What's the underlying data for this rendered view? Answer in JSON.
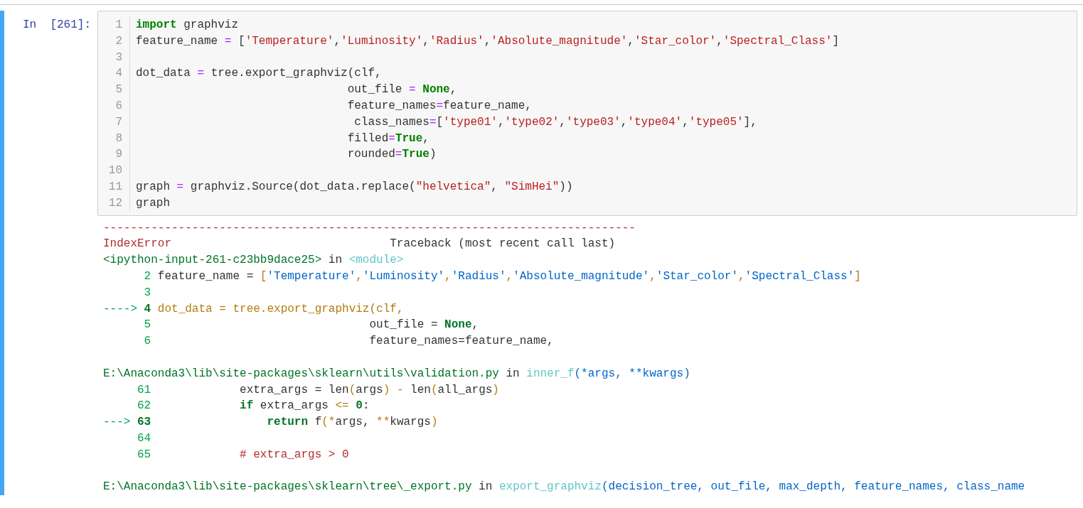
{
  "cell": {
    "selected": true,
    "prompt": "In  [261]:",
    "lines": [
      {
        "number": "1",
        "tokens": [
          {
            "kind": "keyword",
            "text": "import"
          },
          {
            "kind": "plain",
            "text": " graphviz"
          }
        ]
      },
      {
        "number": "2",
        "tokens": [
          {
            "kind": "plain",
            "text": "feature_name "
          },
          {
            "kind": "operator",
            "text": "="
          },
          {
            "kind": "plain",
            "text": " ["
          },
          {
            "kind": "string",
            "text": "'Temperature'"
          },
          {
            "kind": "plain",
            "text": ","
          },
          {
            "kind": "string",
            "text": "'Luminosity'"
          },
          {
            "kind": "plain",
            "text": ","
          },
          {
            "kind": "string",
            "text": "'Radius'"
          },
          {
            "kind": "plain",
            "text": ","
          },
          {
            "kind": "string",
            "text": "'Absolute_magnitude'"
          },
          {
            "kind": "plain",
            "text": ","
          },
          {
            "kind": "string",
            "text": "'Star_color'"
          },
          {
            "kind": "plain",
            "text": ","
          },
          {
            "kind": "string",
            "text": "'Spectral_Class'"
          },
          {
            "kind": "plain",
            "text": "]"
          }
        ]
      },
      {
        "number": "3"
      },
      {
        "number": "4",
        "tokens": [
          {
            "kind": "plain",
            "text": "dot_data "
          },
          {
            "kind": "operator",
            "text": "="
          },
          {
            "kind": "plain",
            "text": " tree.export_graphviz(clf,"
          }
        ]
      },
      {
        "number": "5",
        "tokens": [
          {
            "kind": "plain",
            "text": "                               out_file "
          },
          {
            "kind": "operator",
            "text": "="
          },
          {
            "kind": "constant",
            "text": " None"
          },
          {
            "kind": "plain",
            "text": ","
          }
        ]
      },
      {
        "number": "6",
        "tokens": [
          {
            "kind": "plain",
            "text": "                               feature_names"
          },
          {
            "kind": "operator",
            "text": "="
          },
          {
            "kind": "plain",
            "text": "feature_name,"
          }
        ]
      },
      {
        "number": "7",
        "tokens": [
          {
            "kind": "plain",
            "text": "                                class_names"
          },
          {
            "kind": "operator",
            "text": "="
          },
          {
            "kind": "plain",
            "text": "["
          },
          {
            "kind": "string",
            "text": "'type01'"
          },
          {
            "kind": "plain",
            "text": ","
          },
          {
            "kind": "string",
            "text": "'type02'"
          },
          {
            "kind": "plain",
            "text": ","
          },
          {
            "kind": "string",
            "text": "'type03'"
          },
          {
            "kind": "plain",
            "text": ","
          },
          {
            "kind": "string",
            "text": "'type04'"
          },
          {
            "kind": "plain",
            "text": ","
          },
          {
            "kind": "string",
            "text": "'type05'"
          },
          {
            "kind": "plain",
            "text": "],"
          }
        ]
      },
      {
        "number": "8",
        "tokens": [
          {
            "kind": "plain",
            "text": "                               filled"
          },
          {
            "kind": "operator",
            "text": "="
          },
          {
            "kind": "constant",
            "text": "True"
          },
          {
            "kind": "plain",
            "text": ","
          }
        ]
      },
      {
        "number": "9",
        "tokens": [
          {
            "kind": "plain",
            "text": "                               rounded"
          },
          {
            "kind": "operator",
            "text": "="
          },
          {
            "kind": "constant",
            "text": "True"
          },
          {
            "kind": "plain",
            "text": ")"
          }
        ]
      },
      {
        "number": "10"
      },
      {
        "number": "11",
        "tokens": [
          {
            "kind": "plain",
            "text": "graph "
          },
          {
            "kind": "operator",
            "text": "="
          },
          {
            "kind": "plain",
            "text": " graphviz.Source(dot_data.replace("
          },
          {
            "kind": "string",
            "text": "\"helvetica\""
          },
          {
            "kind": "plain",
            "text": ", "
          },
          {
            "kind": "string",
            "text": "\"SimHei\""
          },
          {
            "kind": "plain",
            "text": "))"
          }
        ]
      },
      {
        "number": "12",
        "tokens": [
          {
            "kind": "plain",
            "text": "graph"
          }
        ]
      }
    ]
  },
  "output": {
    "separator": "------------------------------------------------------------------------------",
    "header": [
      {
        "kind": "error",
        "text": "IndexError"
      },
      {
        "kind": "plain",
        "text": "                                Traceback (most recent call last)"
      }
    ],
    "frames": [
      {
        "lines": [
          [
            {
              "kind": "file",
              "text": "<ipython-input-261-c23bb9dace25>"
            },
            {
              "kind": "plain",
              "text": " in "
            },
            {
              "kind": "function",
              "text": "<module>"
            }
          ],
          [
            {
              "kind": "line_number",
              "text": "      2"
            },
            {
              "kind": "plain",
              "text": " feature_name = "
            },
            {
              "kind": "punct",
              "text": "["
            },
            {
              "kind": "tb_string",
              "text": "'Temperature'"
            },
            {
              "kind": "punct",
              "text": ","
            },
            {
              "kind": "tb_string",
              "text": "'Luminosity'"
            },
            {
              "kind": "punct",
              "text": ","
            },
            {
              "kind": "tb_string",
              "text": "'Radius'"
            },
            {
              "kind": "punct",
              "text": ","
            },
            {
              "kind": "tb_string",
              "text": "'Absolute_magnitude'"
            },
            {
              "kind": "punct",
              "text": ","
            },
            {
              "kind": "tb_string",
              "text": "'Star_color'"
            },
            {
              "kind": "punct",
              "text": ","
            },
            {
              "kind": "tb_string",
              "text": "'Spectral_Class'"
            },
            {
              "kind": "punct",
              "text": "]"
            }
          ],
          [
            {
              "kind": "line_number",
              "text": "      3"
            }
          ],
          [
            {
              "kind": "arrow",
              "text": "----> "
            },
            {
              "kind": "current_number",
              "text": "4"
            },
            {
              "kind": "current_code",
              "text": " dot_data = tree.export_graphviz(clf,"
            }
          ],
          [
            {
              "kind": "line_number",
              "text": "      5"
            },
            {
              "kind": "plain",
              "text": "                                out_file = "
            },
            {
              "kind": "tb_keyword",
              "text": "None"
            },
            {
              "kind": "plain",
              "text": ","
            }
          ],
          [
            {
              "kind": "line_number",
              "text": "      6"
            },
            {
              "kind": "plain",
              "text": "                                feature_names=feature_name,"
            }
          ]
        ]
      },
      {
        "lines": [
          [
            {
              "kind": "file",
              "text": "E:\\Anaconda3\\lib\\site-packages\\sklearn\\utils\\validation.py"
            },
            {
              "kind": "plain",
              "text": " in "
            },
            {
              "kind": "function",
              "text": "inner_f"
            },
            {
              "kind": "arguments",
              "text": "(*args, **kwargs)"
            }
          ],
          [
            {
              "kind": "line_number",
              "text": "     61"
            },
            {
              "kind": "plain",
              "text": "             extra_args = len"
            },
            {
              "kind": "punct",
              "text": "("
            },
            {
              "kind": "plain",
              "text": "args"
            },
            {
              "kind": "punct",
              "text": ")"
            },
            {
              "kind": "punct",
              "text": " -"
            },
            {
              "kind": "plain",
              "text": " len"
            },
            {
              "kind": "punct",
              "text": "("
            },
            {
              "kind": "plain",
              "text": "all_args"
            },
            {
              "kind": "punct",
              "text": ")"
            }
          ],
          [
            {
              "kind": "line_number",
              "text": "     62             "
            },
            {
              "kind": "tb_keyword",
              "text": "if"
            },
            {
              "kind": "plain",
              "text": " extra_args "
            },
            {
              "kind": "punct",
              "text": "<= "
            },
            {
              "kind": "tb_number",
              "text": "0"
            },
            {
              "kind": "plain",
              "text": ":"
            }
          ],
          [
            {
              "kind": "arrow",
              "text": "---> "
            },
            {
              "kind": "current_number",
              "text": "63"
            },
            {
              "kind": "tb_keyword",
              "text": "                 return"
            },
            {
              "kind": "plain",
              "text": " f"
            },
            {
              "kind": "punct",
              "text": "(*"
            },
            {
              "kind": "plain",
              "text": "args, "
            },
            {
              "kind": "punct",
              "text": "**"
            },
            {
              "kind": "plain",
              "text": "kwargs"
            },
            {
              "kind": "punct",
              "text": ")"
            }
          ],
          [
            {
              "kind": "line_number",
              "text": "     64"
            }
          ],
          [
            {
              "kind": "line_number",
              "text": "     65             "
            },
            {
              "kind": "comment",
              "text": "# extra_args > 0"
            }
          ]
        ]
      },
      {
        "lines": [
          [
            {
              "kind": "file",
              "text": "E:\\Anaconda3\\lib\\site-packages\\sklearn\\tree\\_export.py"
            },
            {
              "kind": "plain",
              "text": " in "
            },
            {
              "kind": "function",
              "text": "export_graphviz"
            },
            {
              "kind": "arguments",
              "text": "(decision_tree, out_file, max_depth, feature_names, class_name"
            }
          ]
        ]
      }
    ]
  }
}
